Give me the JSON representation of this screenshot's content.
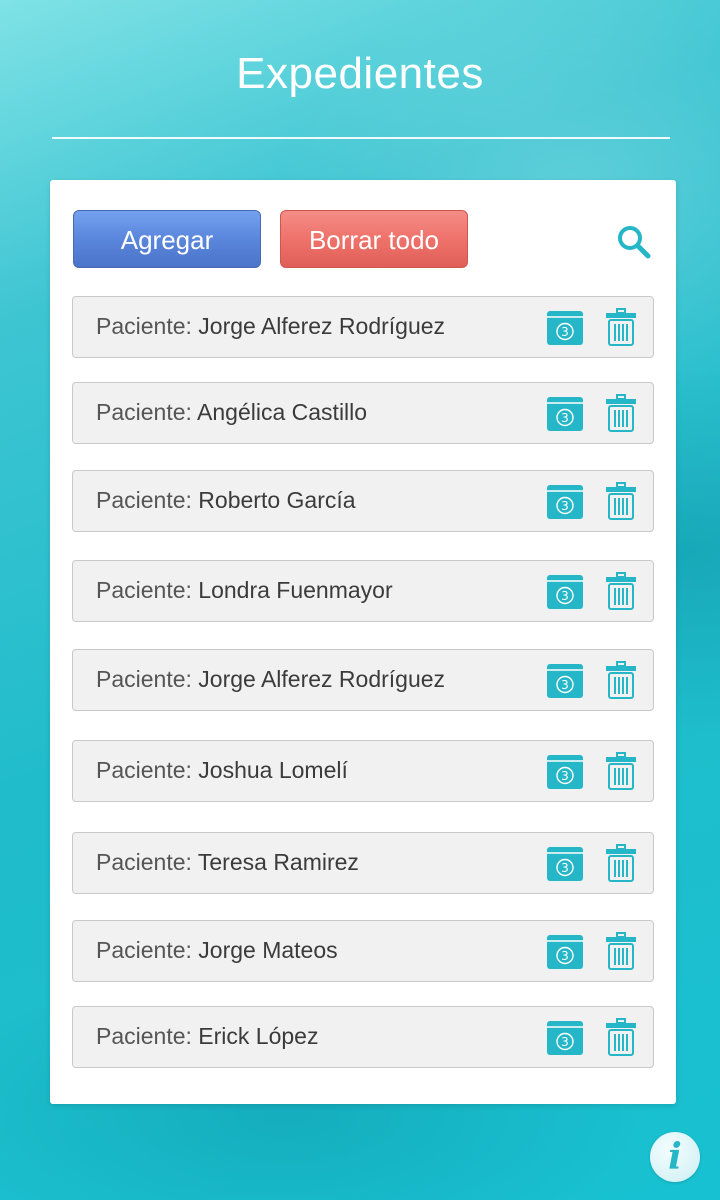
{
  "header": {
    "title": "Expedientes"
  },
  "toolbar": {
    "add_label": "Agregar",
    "clear_label": "Borrar todo",
    "search_icon": "search-icon"
  },
  "patients": {
    "prefix": "Paciente:",
    "items": [
      {
        "name": "Jorge Alferez Rodríguez",
        "folder_badge": "3"
      },
      {
        "name": "Angélica Castillo",
        "folder_badge": "3"
      },
      {
        "name": "Roberto García",
        "folder_badge": "3"
      },
      {
        "name": "Londra Fuenmayor",
        "folder_badge": "3"
      },
      {
        "name": "Jorge Alferez Rodríguez",
        "folder_badge": "3"
      },
      {
        "name": "Joshua Lomelí",
        "folder_badge": "3"
      },
      {
        "name": "Teresa Ramirez",
        "folder_badge": "3"
      },
      {
        "name": "Jorge Mateos",
        "folder_badge": "3"
      },
      {
        "name": "Erick López",
        "folder_badge": "3"
      }
    ]
  },
  "footer": {
    "info_glyph": "i"
  },
  "colors": {
    "accent": "#25b7c7",
    "add_button": "#5a86dc",
    "clear_button": "#ee726b",
    "row_background": "#f1f1f1"
  }
}
